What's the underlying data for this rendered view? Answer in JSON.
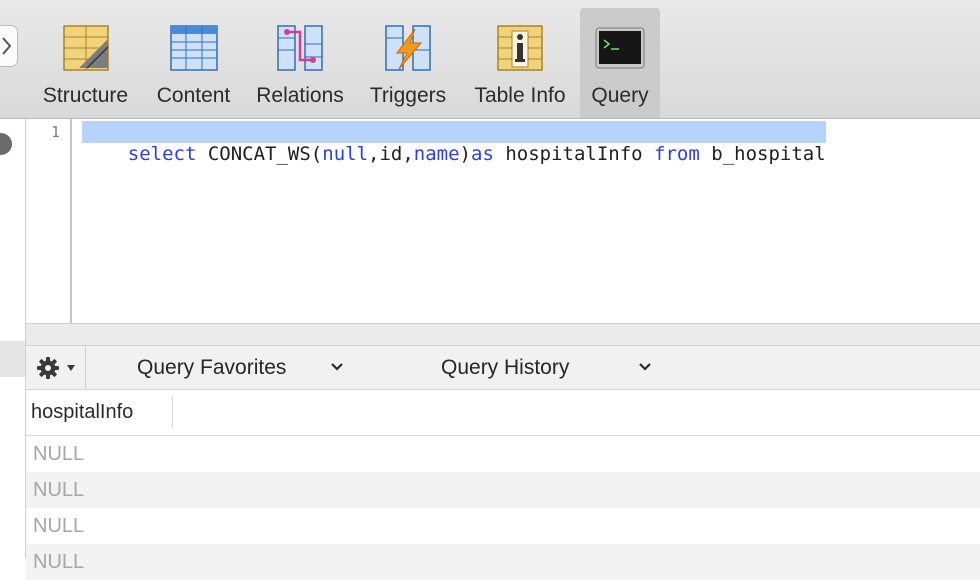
{
  "toolbar": {
    "items": [
      {
        "label": "Structure",
        "icon": "structure-icon"
      },
      {
        "label": "Content",
        "icon": "content-icon"
      },
      {
        "label": "Relations",
        "icon": "relations-icon"
      },
      {
        "label": "Triggers",
        "icon": "triggers-icon"
      },
      {
        "label": "Table Info",
        "icon": "table-info-icon"
      },
      {
        "label": "Query",
        "icon": "terminal-icon",
        "selected": true
      }
    ]
  },
  "editor": {
    "line_number": "1",
    "code_tokens": [
      {
        "text": "select",
        "kind": "keyword"
      },
      {
        "text": " CONCAT_WS(",
        "kind": "plain"
      },
      {
        "text": "null",
        "kind": "keyword"
      },
      {
        "text": ",id,",
        "kind": "plain"
      },
      {
        "text": "name",
        "kind": "keyword"
      },
      {
        "text": ")",
        "kind": "plain"
      },
      {
        "text": "as",
        "kind": "keyword"
      },
      {
        "text": " hospitalInfo ",
        "kind": "plain"
      },
      {
        "text": "from",
        "kind": "keyword"
      },
      {
        "text": " b_hospital",
        "kind": "plain"
      }
    ]
  },
  "query_bar": {
    "favorites_label": "Query Favorites",
    "history_label": "Query History"
  },
  "results": {
    "column": "hospitalInfo",
    "rows": [
      "NULL",
      "NULL",
      "NULL",
      "NULL"
    ]
  },
  "colors": {
    "keyword": "#2d3de6",
    "selection": "#b4d4fb",
    "null_text": "#a6a6a6"
  }
}
